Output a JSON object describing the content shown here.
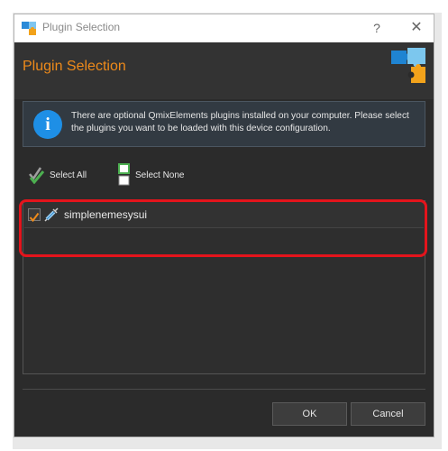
{
  "window": {
    "title": "Plugin Selection",
    "help_label": "?",
    "close_label": "✕"
  },
  "header": {
    "title": "Plugin Selection"
  },
  "info": {
    "icon_glyph": "i",
    "text": "There are optional QmixElements plugins installed on your computer. Please select the plugins you want to be loaded with this device configuration."
  },
  "toolbar": {
    "select_all_label": "Select All",
    "select_none_label": "Select None"
  },
  "plugins": [
    {
      "name": "simplenemesysui",
      "checked": true
    }
  ],
  "footer": {
    "ok_label": "OK",
    "cancel_label": "Cancel"
  },
  "colors": {
    "accent": "#ee8a1a",
    "info_blue": "#1e8fe6",
    "highlight_red": "#e4141c",
    "check_green": "#4caf50"
  }
}
